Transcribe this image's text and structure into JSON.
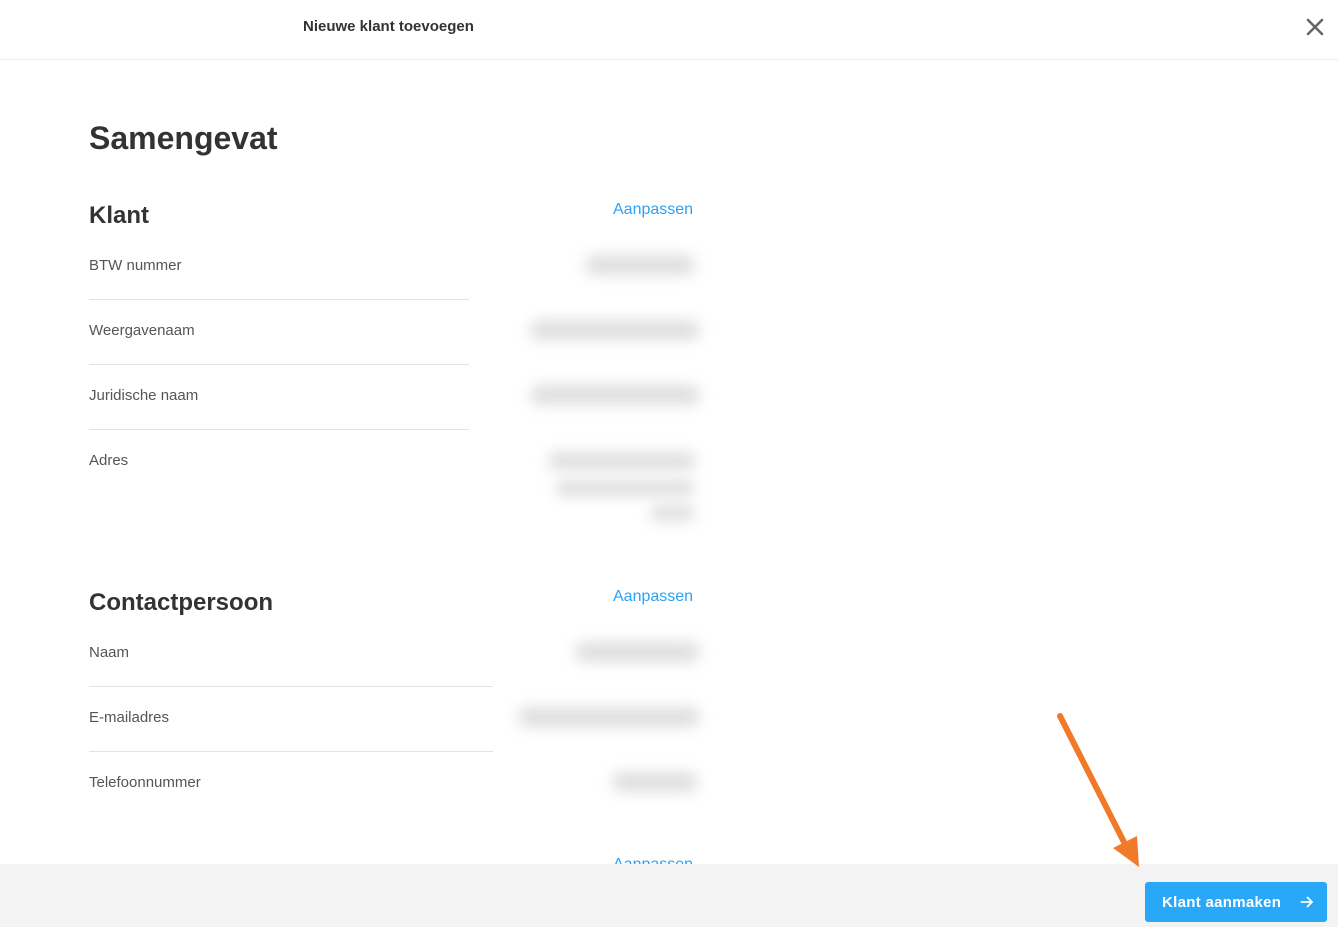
{
  "header": {
    "title": "Nieuwe klant toevoegen",
    "close_icon": "close-icon"
  },
  "summary": {
    "title": "Samengevat"
  },
  "client_section": {
    "title": "Klant",
    "edit_label": "Aanpassen",
    "fields": [
      {
        "label": "BTW nummer"
      },
      {
        "label": "Weergavenaam"
      },
      {
        "label": "Juridische naam"
      },
      {
        "label": "Adres"
      }
    ]
  },
  "contact_section": {
    "title": "Contactpersoon",
    "edit_label": "Aanpassen",
    "fields": [
      {
        "label": "Naam"
      },
      {
        "label": "E-mailadres"
      },
      {
        "label": "Telefoonnummer"
      }
    ]
  },
  "third_section": {
    "edit_label": "Aanpassen"
  },
  "footer": {
    "create_button_label": "Klant aanmaken",
    "create_button_icon": "arrow-right-icon"
  },
  "colors": {
    "accent": "#2aa8f8",
    "link": "#2aa2f5",
    "annotation_arrow": "#f07a2a"
  }
}
